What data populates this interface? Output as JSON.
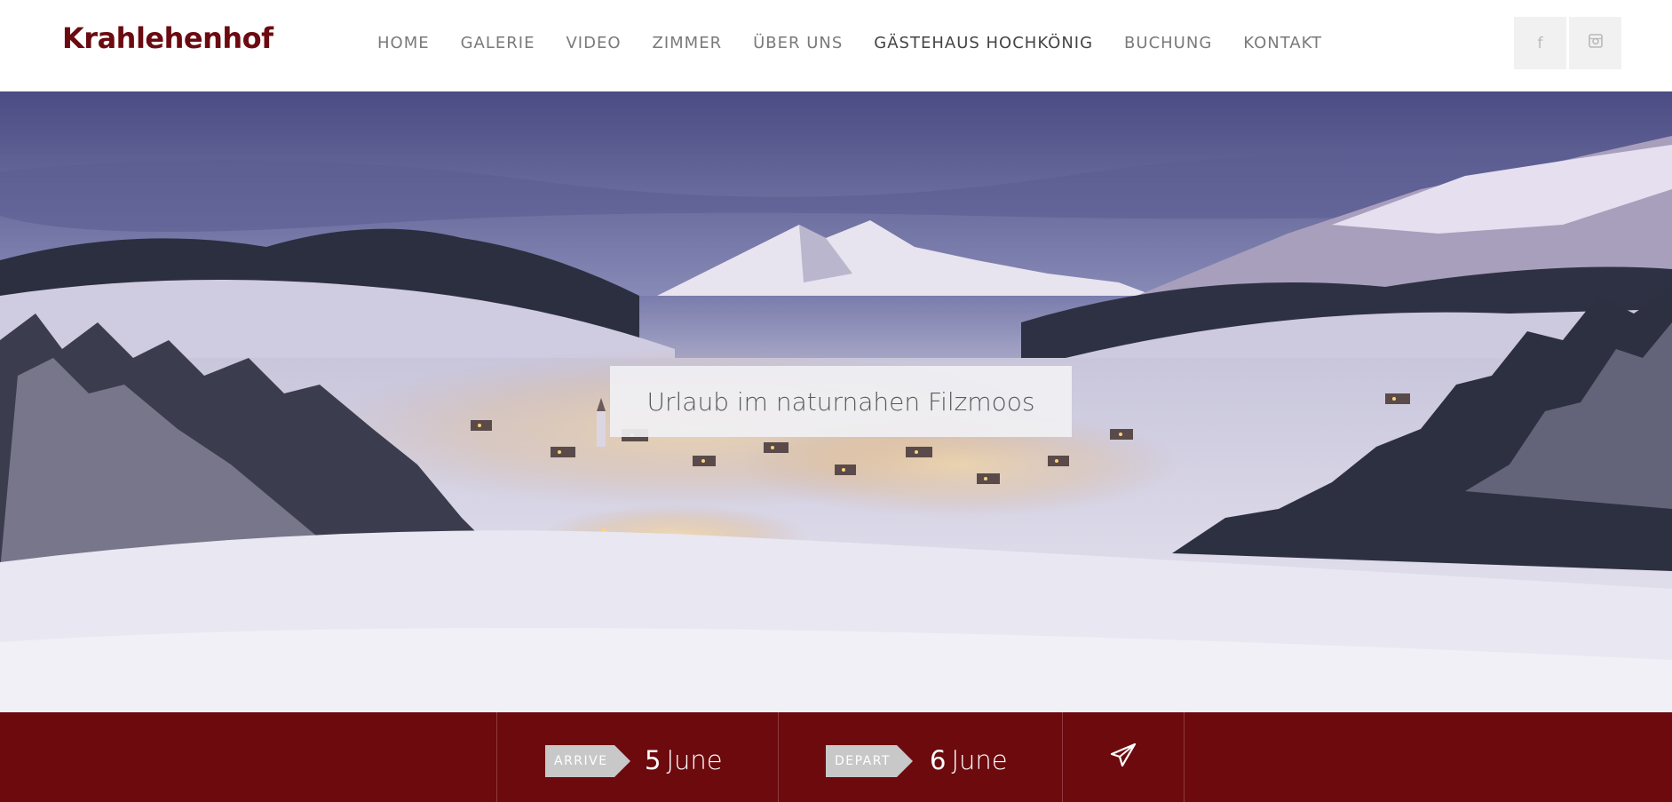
{
  "header": {
    "logo": "Krahlehenhof",
    "nav": [
      {
        "label": "HOME"
      },
      {
        "label": "GALERIE"
      },
      {
        "label": "VIDEO"
      },
      {
        "label": "ZIMMER"
      },
      {
        "label": "ÜBER UNS"
      },
      {
        "label": "GÄSTEHAUS HOCHKÖNIG"
      },
      {
        "label": "BUCHUNG"
      },
      {
        "label": "KONTAKT"
      }
    ],
    "social": [
      {
        "icon": "facebook-icon",
        "glyph": "f"
      },
      {
        "icon": "instagram-icon",
        "glyph": "◙"
      }
    ]
  },
  "hero": {
    "tagline": "Urlaub im naturnahen Filzmoos",
    "image": "snowy mountain village at dusk"
  },
  "booking": {
    "arrive_label": "ARRIVE",
    "arrive_day": "5",
    "arrive_month": "June",
    "depart_label": "DEPART",
    "depart_day": "6",
    "depart_month": "June",
    "send_icon": "paper-plane-icon"
  },
  "colors": {
    "brand": "#6b0a10",
    "booking_bar": "#6d0a0e",
    "nav_text": "#7a7a7a"
  }
}
